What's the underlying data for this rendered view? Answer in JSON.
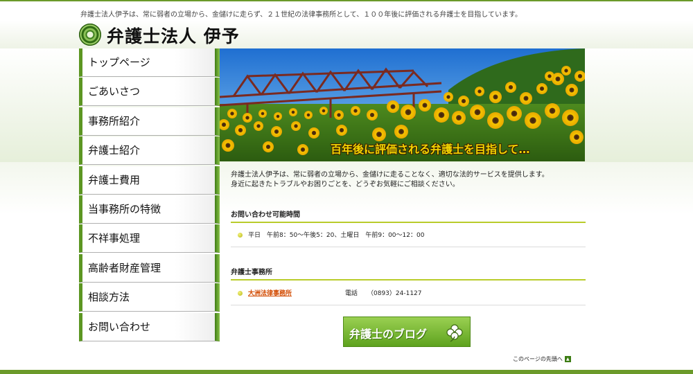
{
  "header": {
    "tagline": "弁護士法人伊予は、常に弱者の立場から、金儲けに走らず、２１世紀の法律事務所として、１００年後に評価される弁護士を目指しています。",
    "title": "弁護士法人 伊予"
  },
  "sidebar": {
    "items": [
      {
        "label": "トップページ"
      },
      {
        "label": "ごあいさつ"
      },
      {
        "label": "事務所紹介"
      },
      {
        "label": "弁護士紹介"
      },
      {
        "label": "弁護士費用"
      },
      {
        "label": "当事務所の特徴"
      },
      {
        "label": "不祥事処理"
      },
      {
        "label": "高齢者財産管理"
      },
      {
        "label": "相談方法"
      },
      {
        "label": "お問い合わせ"
      }
    ]
  },
  "hero": {
    "caption": "百年後に評価される弁護士を目指して…"
  },
  "main": {
    "intro_line1": "弁護士法人伊予は、常に弱者の立場から、金儲けに走ることなく、適切な法的サービスを提供します。",
    "intro_line2": "身近に起きたトラブルやお困りごとを、どうぞお気軽にご相談ください。",
    "hours_heading": "お問い合わせ可能時間",
    "hours_text": "平日　午前8：50〜午後5：20、土曜日　午前9：00〜12：00",
    "offices_heading": "弁護士事務所",
    "office_name": "大洲法律事務所",
    "phone_label": "電話",
    "phone_number": "（0893）24-1127",
    "blog_label": "弁護士のブログ",
    "back_to_top": "このページの先頭へ"
  },
  "colors": {
    "accent_green": "#5c9622",
    "section_underline": "#b9cc2a",
    "link_orange": "#d24a00"
  }
}
